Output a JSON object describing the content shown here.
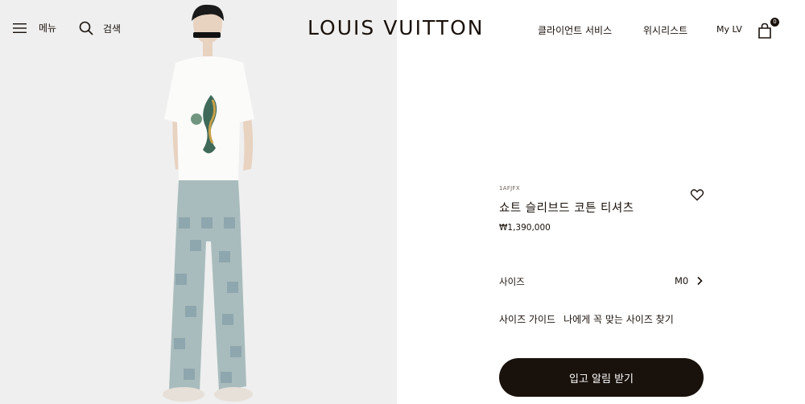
{
  "header": {
    "menu_label": "메뉴",
    "search_label": "검색",
    "logo": "LOUIS VUITTON",
    "client_service": "클라이언트 서비스",
    "wishlist": "위시리스트",
    "my_lv": "My LV",
    "bag_count": "0"
  },
  "product": {
    "sku": "1AFJFX",
    "title": "쇼트 슬리브드 코튼 티셔츠",
    "price": "₩1,390,000",
    "size_label": "사이즈",
    "size_value": "M0",
    "size_guide": "사이즈 가이드",
    "find_size": "나에게 꼭 맞는 사이즈 찾기",
    "cta": "입고 알림 받기"
  },
  "colors": {
    "brand_dark": "#19110b",
    "image_bg": "#efefef"
  }
}
